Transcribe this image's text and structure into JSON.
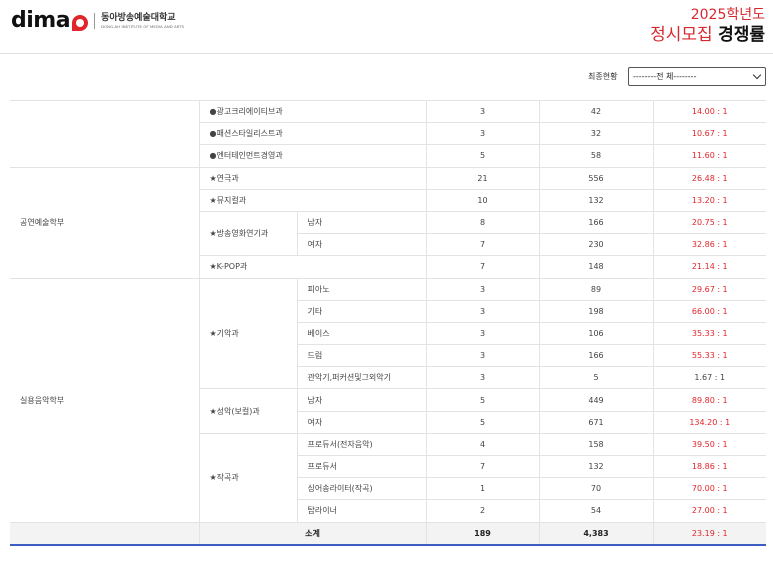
{
  "header": {
    "logo_word": "dima",
    "logo_korean": "동아방송예술대학교",
    "logo_english": "DONG-AH INSTITUTE OF MEDIA AND ARTS",
    "year": "2025학년도",
    "title_red": "정시모집",
    "title_black": "경쟁률"
  },
  "filter": {
    "label": "최종현황",
    "selected": "--------전 체--------"
  },
  "colors": {
    "accent_red": "#e0262b",
    "total_underline": "#3c5dc2"
  },
  "table": {
    "rows_top": [
      {
        "dept": "●광고크리에이티브과",
        "quota": "3",
        "applicants": "42",
        "rate": "14.00 : 1"
      },
      {
        "dept": "●패션스타일리스트과",
        "quota": "3",
        "applicants": "32",
        "rate": "10.67 : 1"
      },
      {
        "dept": "●엔터테인먼트경영과",
        "quota": "5",
        "applicants": "58",
        "rate": "11.60 : 1"
      }
    ],
    "group_perf": "공연예술학부",
    "rows_perf": [
      {
        "dept": "★연극과",
        "quota": "21",
        "applicants": "556",
        "rate": "26.48 : 1"
      },
      {
        "dept": "★뮤지컬과",
        "quota": "10",
        "applicants": "132",
        "rate": "13.20 : 1"
      },
      {
        "dept": "★방송영화연기과",
        "sub": "남자",
        "quota": "8",
        "applicants": "166",
        "rate": "20.75 : 1"
      },
      {
        "sub": "여자",
        "quota": "7",
        "applicants": "230",
        "rate": "32.86 : 1"
      },
      {
        "dept": "★K-POP과",
        "quota": "7",
        "applicants": "148",
        "rate": "21.14 : 1"
      }
    ],
    "group_music": "실용음악학부",
    "dept_instrument": "★기악과",
    "rows_instrument": [
      {
        "sub": "피아노",
        "quota": "3",
        "applicants": "89",
        "rate": "29.67 : 1"
      },
      {
        "sub": "기타",
        "quota": "3",
        "applicants": "198",
        "rate": "66.00 : 1"
      },
      {
        "sub": "베이스",
        "quota": "3",
        "applicants": "106",
        "rate": "35.33 : 1"
      },
      {
        "sub": "드럼",
        "quota": "3",
        "applicants": "166",
        "rate": "55.33 : 1"
      },
      {
        "sub": "관악기,퍼커션및그외악기",
        "quota": "3",
        "applicants": "5",
        "rate": "1.67 : 1"
      }
    ],
    "dept_vocal": "★성악(보컬)과",
    "rows_vocal": [
      {
        "sub": "남자",
        "quota": "5",
        "applicants": "449",
        "rate": "89.80 : 1"
      },
      {
        "sub": "여자",
        "quota": "5",
        "applicants": "671",
        "rate": "134.20 : 1"
      }
    ],
    "dept_compose": "★작곡과",
    "rows_compose": [
      {
        "sub": "프로듀서(전자음악)",
        "quota": "4",
        "applicants": "158",
        "rate": "39.50 : 1"
      },
      {
        "sub": "프로듀서",
        "quota": "7",
        "applicants": "132",
        "rate": "18.86 : 1"
      },
      {
        "sub": "싱어송라이터(작곡)",
        "quota": "1",
        "applicants": "70",
        "rate": "70.00 : 1"
      },
      {
        "sub": "탑라이너",
        "quota": "2",
        "applicants": "54",
        "rate": "27.00 : 1"
      }
    ],
    "total": {
      "label": "소계",
      "quota": "189",
      "applicants": "4,383",
      "rate": "23.19 : 1"
    }
  }
}
